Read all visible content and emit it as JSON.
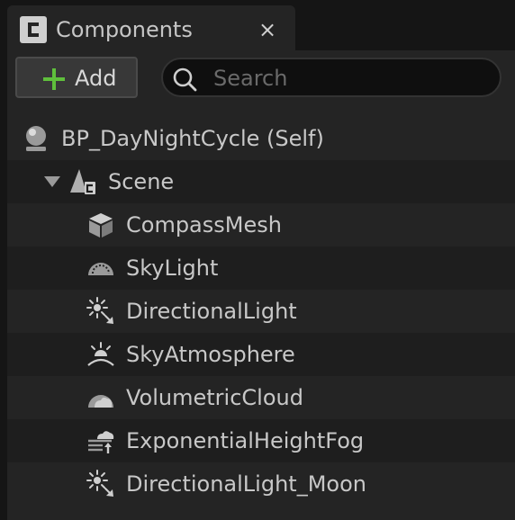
{
  "tab": {
    "title": "Components",
    "close": "×"
  },
  "toolbar": {
    "add_label": "Add",
    "search_placeholder": "Search"
  },
  "tree": {
    "root": {
      "label": "BP_DayNightCycle (Self)",
      "icon": "actor-sphere-icon"
    },
    "scene": {
      "label": "Scene",
      "icon": "scene-component-icon",
      "expanded": true
    },
    "children": [
      {
        "label": "CompassMesh",
        "icon": "static-mesh-icon"
      },
      {
        "label": "SkyLight",
        "icon": "skylight-icon"
      },
      {
        "label": "DirectionalLight",
        "icon": "directional-light-icon"
      },
      {
        "label": "SkyAtmosphere",
        "icon": "sky-atmosphere-icon"
      },
      {
        "label": "VolumetricCloud",
        "icon": "volumetric-cloud-icon"
      },
      {
        "label": "ExponentialHeightFog",
        "icon": "height-fog-icon"
      },
      {
        "label": "DirectionalLight_Moon",
        "icon": "directional-light-icon"
      }
    ]
  },
  "colors": {
    "add_accent": "#5fbf3c",
    "panel_bg": "#242424",
    "row_alt": "#1e1e1e"
  }
}
